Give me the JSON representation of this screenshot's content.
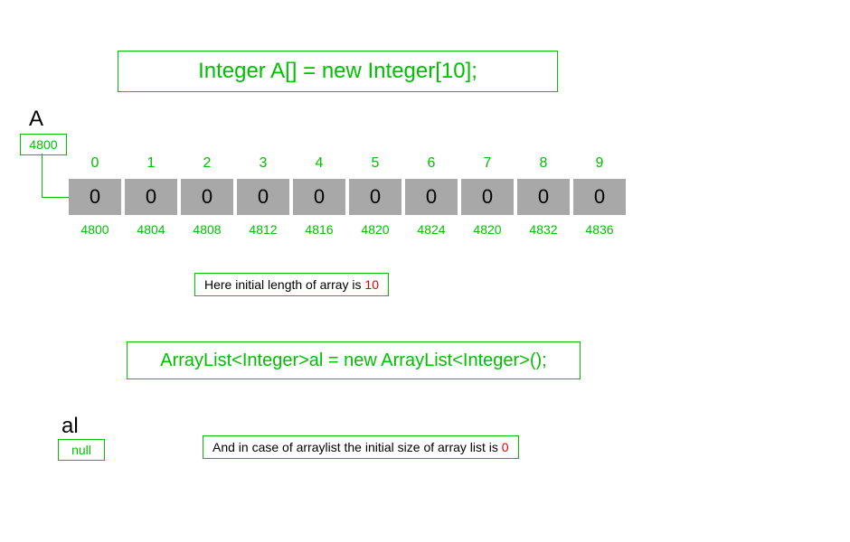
{
  "declaration1": "Integer A[] = new Integer[10];",
  "declaration2": "ArrayList<Integer>al = new ArrayList<Integer>();",
  "varA": "A",
  "varAl": "al",
  "refA": "4800",
  "refAl": "null",
  "array": {
    "indices": [
      "0",
      "1",
      "2",
      "3",
      "4",
      "5",
      "6",
      "7",
      "8",
      "9"
    ],
    "values": [
      "0",
      "0",
      "0",
      "0",
      "0",
      "0",
      "0",
      "0",
      "0",
      "0"
    ],
    "addresses": [
      "4800",
      "4804",
      "4808",
      "4812",
      "4816",
      "4820",
      "4824",
      "4820",
      "4832",
      "4836"
    ]
  },
  "note1_prefix": "Here initial length of array  is ",
  "note1_value": "10",
  "note2_prefix": "And in case of arraylist the initial size of array list is ",
  "note2_value": "0"
}
